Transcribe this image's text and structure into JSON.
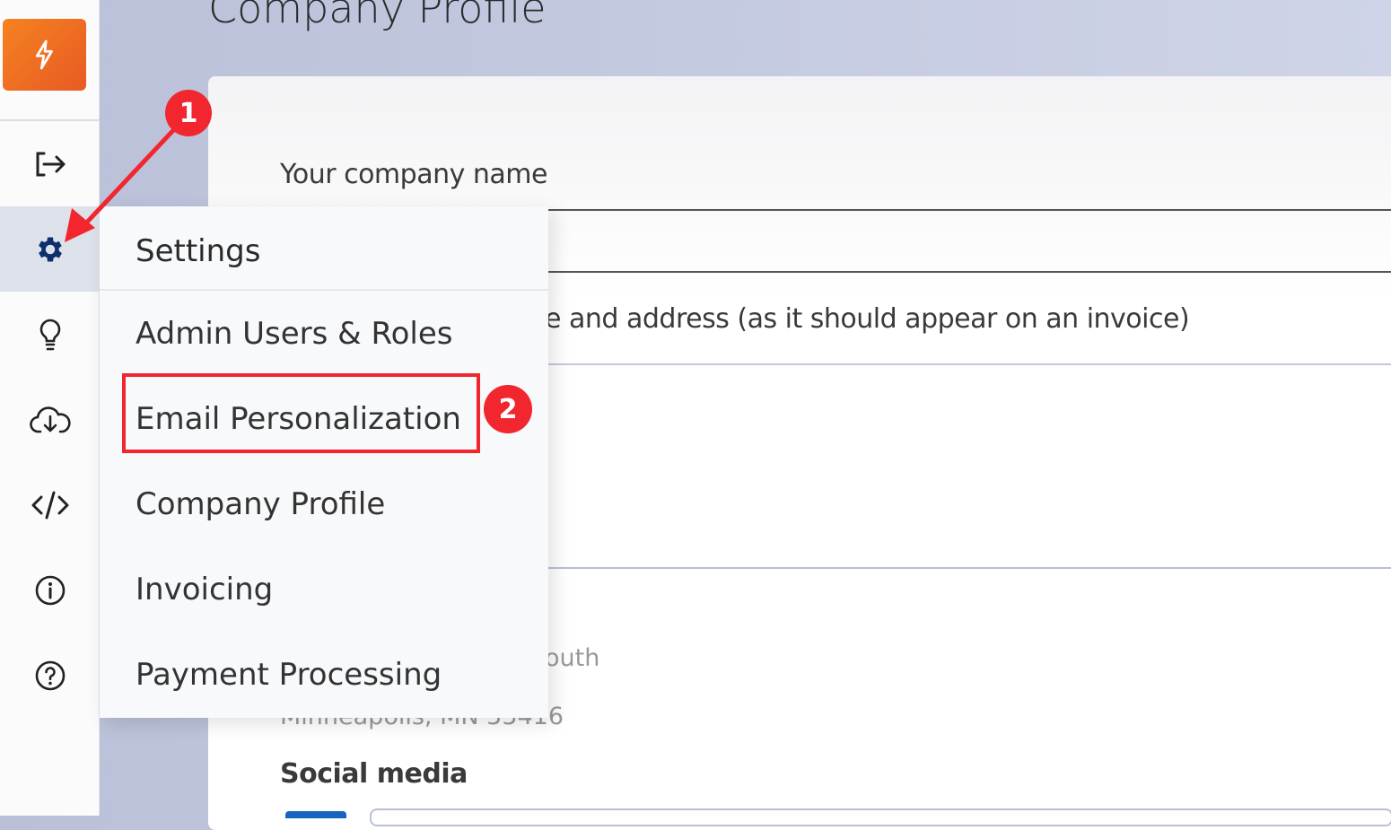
{
  "page": {
    "title": "Company Profile"
  },
  "sidebar": {
    "items": [
      {
        "icon": "logout-icon"
      },
      {
        "icon": "gear-icon",
        "active": true
      },
      {
        "icon": "lightbulb-icon"
      },
      {
        "icon": "cloud-download-icon"
      },
      {
        "icon": "code-icon"
      },
      {
        "icon": "info-icon"
      },
      {
        "icon": "help-icon"
      }
    ]
  },
  "form": {
    "company_name_label": "Your company name",
    "address_label_fragment": "e and address (as it should appear on an invoice)",
    "address_line_fragment": "outh",
    "address_city": "Minneapolis, MN 55416",
    "social_label": "Social media"
  },
  "menu": {
    "header": "Settings",
    "items": [
      "Admin Users & Roles",
      "Email Personalization",
      "Company Profile",
      "Invoicing",
      "Payment Processing"
    ]
  },
  "annotations": {
    "step1": "1",
    "step2": "2",
    "color": "#f2262f"
  },
  "colors": {
    "logo": "#f58220",
    "gear_active": "#0d2f6e"
  }
}
